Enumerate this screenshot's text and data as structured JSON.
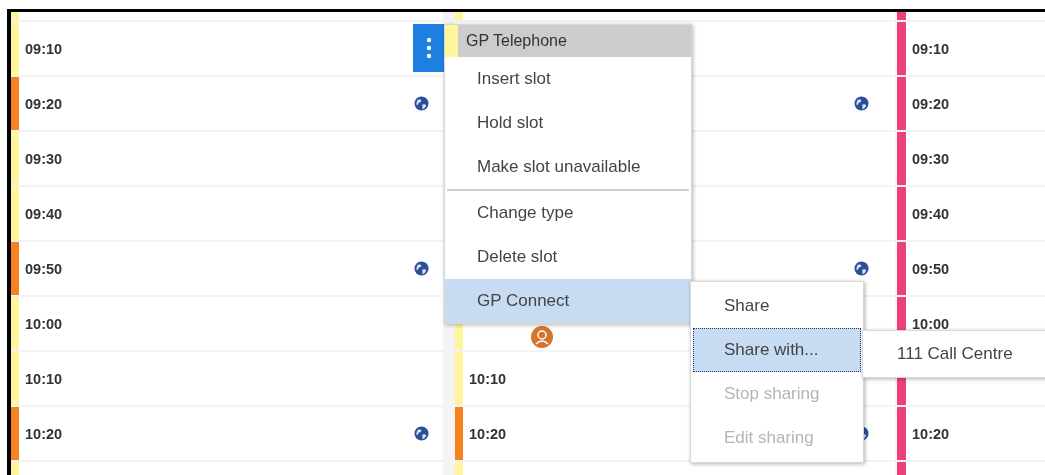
{
  "columns": [
    {
      "rows": [
        {
          "color": "#fff59d"
        },
        {
          "time": "09:10",
          "color": "#fff59d",
          "globe": false
        },
        {
          "time": "09:20",
          "color": "#f5821f",
          "globe": true
        },
        {
          "time": "09:30",
          "color": "#fff59d",
          "globe": false
        },
        {
          "time": "09:40",
          "color": "#fff59d",
          "globe": false
        },
        {
          "time": "09:50",
          "color": "#f5821f",
          "globe": true
        },
        {
          "time": "10:00",
          "color": "#fff59d",
          "globe": false
        },
        {
          "time": "10:10",
          "color": "#fff59d",
          "globe": false
        },
        {
          "time": "10:20",
          "color": "#f5821f",
          "globe": true
        },
        {
          "color": "#fff59d"
        }
      ]
    },
    {
      "rows": [
        {
          "color": "#fff59d"
        },
        {
          "globe": false
        },
        {
          "globe": true
        },
        {
          "globe": false
        },
        {
          "globe": false
        },
        {
          "globe": true
        },
        {
          "color": "#fff59d",
          "globe": false,
          "avatar": true
        },
        {
          "time": "10:10",
          "color": "#fff59d",
          "globe": false
        },
        {
          "time": "10:20",
          "color": "#f5821f",
          "globe": true
        },
        {
          "color": "#fff59d"
        }
      ]
    },
    {
      "rows": [
        {
          "color": "#ec407a"
        },
        {
          "time": "09:10",
          "color": "#ec407a"
        },
        {
          "time": "09:20",
          "color": "#ec407a"
        },
        {
          "time": "09:30",
          "color": "#ec407a"
        },
        {
          "time": "09:40",
          "color": "#ec407a"
        },
        {
          "time": "09:50",
          "color": "#ec407a"
        },
        {
          "time": "10:00",
          "color": "#ec407a"
        },
        {
          "color": "#ec407a"
        },
        {
          "time": "10:20",
          "color": "#ec407a"
        },
        {
          "color": "#ec407a"
        }
      ]
    }
  ],
  "context_menu": {
    "title": "GP Telephone",
    "color": "#fff59d",
    "groups": [
      [
        {
          "label": "Insert slot",
          "selected": false,
          "disabled": false
        },
        {
          "label": "Hold slot",
          "selected": false,
          "disabled": false
        },
        {
          "label": "Make slot unavailable",
          "selected": false,
          "disabled": false
        }
      ],
      [
        {
          "label": "Change type",
          "selected": false,
          "disabled": false
        },
        {
          "label": "Delete slot",
          "selected": false,
          "disabled": false
        },
        {
          "label": "GP Connect",
          "selected": true,
          "disabled": false
        }
      ]
    ]
  },
  "submenu": {
    "items": [
      {
        "label": "Share",
        "selected": false,
        "disabled": false
      },
      {
        "label": "Share with...",
        "selected": true,
        "disabled": false
      },
      {
        "label": "Stop sharing",
        "selected": false,
        "disabled": true
      },
      {
        "label": "Edit sharing",
        "selected": false,
        "disabled": true
      }
    ]
  },
  "submenu_2": {
    "items": [
      {
        "label": "111 Call Centre",
        "selected": false,
        "disabled": false
      }
    ]
  }
}
